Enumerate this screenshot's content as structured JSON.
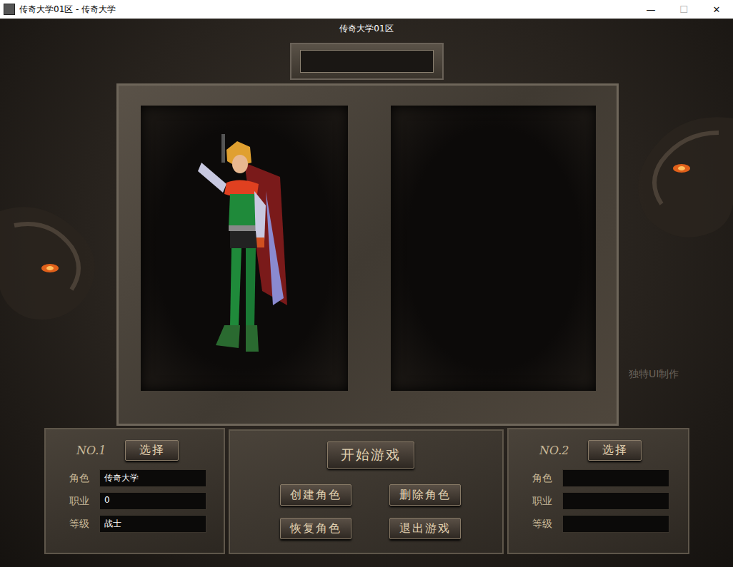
{
  "window": {
    "title": "传奇大学01区 - 传奇大学",
    "controls": [
      "—",
      "☐",
      "✕"
    ]
  },
  "server": {
    "name": "传奇大学01区"
  },
  "name_box": {
    "value": ""
  },
  "slots": [
    {
      "label": "NO.1",
      "select": "选择",
      "has_character": true,
      "fields": [
        {
          "label": "角色",
          "value": "传奇大学"
        },
        {
          "label": "职业",
          "value": "0"
        },
        {
          "label": "等级",
          "value": "战士"
        }
      ]
    },
    {
      "label": "NO.2",
      "select": "选择",
      "has_character": false,
      "fields": [
        {
          "label": "角色",
          "value": ""
        },
        {
          "label": "职业",
          "value": ""
        },
        {
          "label": "等级",
          "value": ""
        }
      ]
    }
  ],
  "actions": {
    "start": "开始游戏",
    "buttons": [
      "创建角色",
      "删除角色",
      "恢复角色",
      "退出游戏"
    ]
  },
  "watermark": "独特UI制作"
}
